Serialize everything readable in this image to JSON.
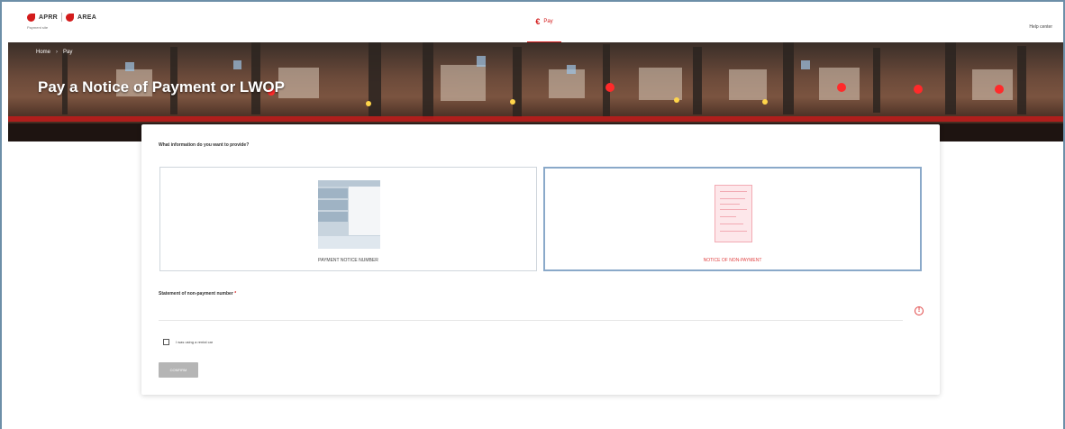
{
  "header": {
    "logo": {
      "brand_left": "APRR",
      "brand_right": "AREA",
      "subtitle": "Payment site"
    },
    "nav": {
      "pay_icon": "€",
      "pay_label": "Pay"
    },
    "help_label": "Help center"
  },
  "banner": {
    "breadcrumb": [
      "Home",
      "Pay"
    ],
    "breadcrumb_separator": "›",
    "title": "Pay a Notice of Payment or LWOP"
  },
  "form": {
    "question": "What information do you want to provide?",
    "options": [
      {
        "label": "PAYMENT NOTICE NUMBER",
        "selected": false
      },
      {
        "label": "NOTICE OF NON-PAYMENT",
        "selected": true
      }
    ],
    "field_label": "Statement of non-payment number",
    "required_mark": "*",
    "field_value": "",
    "error_icon": "!",
    "checkbox_label": "I was using a rental car",
    "confirm_label": "CONFIRM"
  },
  "colors": {
    "accent": "#d31b1b",
    "selected_border": "#8aa9c9",
    "disabled_button": "#b5b5b5"
  }
}
